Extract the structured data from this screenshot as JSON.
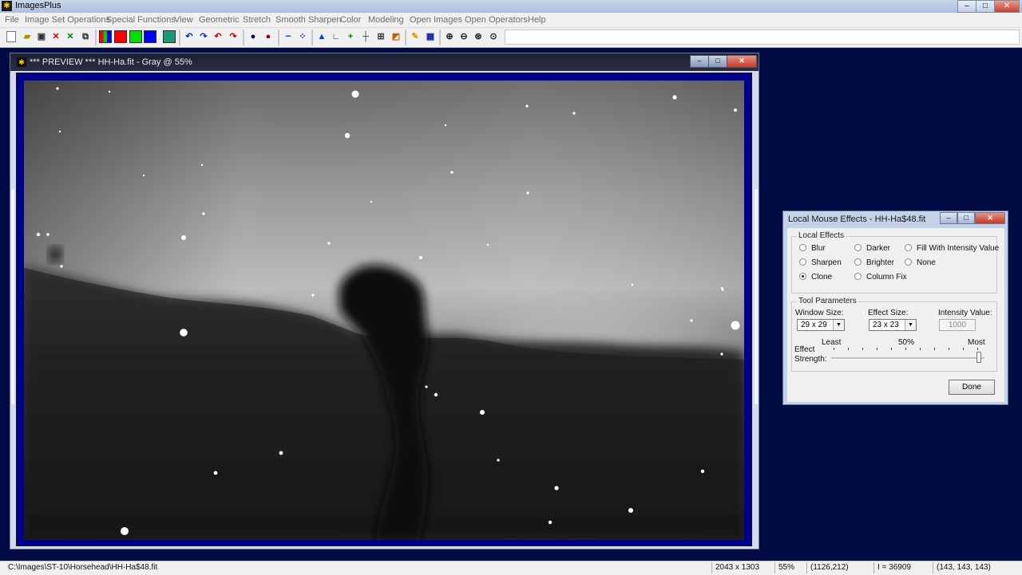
{
  "app": {
    "title": "ImagesPlus",
    "window_controls": {
      "min": "–",
      "max": "□",
      "close": "✕"
    }
  },
  "menu": [
    "File",
    "Image Set Operations",
    "Special Functions",
    "View",
    "Geometric",
    "Stretch",
    "Smooth Sharpen",
    "Color",
    "Modeling",
    "Open Images",
    "Open Operators",
    "Help"
  ],
  "toolbar": {
    "icons": [
      "new-icon",
      "open-icon",
      "save-icon",
      "close-x-icon",
      "check-x-icon",
      "copy-icon",
      "rgb-split-icon",
      "red-icon",
      "green-icon",
      "blue-icon",
      "grid-icon",
      "undo-icon",
      "redo-icon",
      "undo2-icon",
      "redo2-icon",
      "dot-icon",
      "dot-red-icon",
      "dotted-line-icon",
      "scatter-icon",
      "histogram-icon",
      "axis-icon",
      "plus-icon",
      "crosshair-icon",
      "select-icon",
      "paint-icon",
      "pencil-icon",
      "table-icon",
      "zoom-in-icon",
      "zoom-out-icon",
      "zoom-fit-icon",
      "zoom-actual-icon"
    ]
  },
  "preview": {
    "title": "*** PREVIEW *** HH-Ha.fit - Gray @ 55%"
  },
  "dialog": {
    "title": "Local Mouse Effects - HH-Ha$48.fit",
    "local_effects_title": "Local Effects",
    "effects": [
      {
        "label": "Blur",
        "selected": false
      },
      {
        "label": "Darker",
        "selected": false
      },
      {
        "label": "Fill With Intensity Value",
        "selected": false
      },
      {
        "label": "Sharpen",
        "selected": false
      },
      {
        "label": "Brighter",
        "selected": false
      },
      {
        "label": "None",
        "selected": false
      },
      {
        "label": "Clone",
        "selected": true
      },
      {
        "label": "Column Fix",
        "selected": false
      }
    ],
    "tool_params_title": "Tool Parameters",
    "window_size_label": "Window Size:",
    "window_size_value": "29 x 29",
    "effect_size_label": "Effect Size:",
    "effect_size_value": "23 x 23",
    "intensity_label": "Intensity Value:",
    "intensity_value": "1000",
    "slider_least": "Least",
    "slider_mid": "50%",
    "slider_most": "Most",
    "effect_label": "Effect",
    "strength_label": "Strength:",
    "strength_level": 0.98,
    "done_label": "Done"
  },
  "status": {
    "path": "C:\\Images\\ST-10\\Horsehead\\HH-Ha$48.fit",
    "dimensions": "2043 x 1303",
    "zoom": "55%",
    "coords": "(1126,212)",
    "intensity": "I = 36909",
    "rgb": "(143, 143, 143)"
  },
  "colors": {
    "desktop": "#000b44",
    "frame": "#00008a",
    "red": "#ff0000",
    "green": "#00d000",
    "blue": "#0000ff"
  }
}
